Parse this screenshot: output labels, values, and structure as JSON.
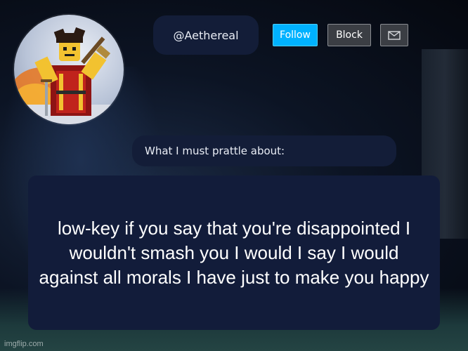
{
  "profile": {
    "username": "@Aethereal",
    "avatar_icon": "roblox-character-avatar-icon"
  },
  "actions": {
    "follow_label": "Follow",
    "block_label": "Block",
    "message_icon": "mail-icon"
  },
  "prompt": {
    "label": "What I must prattle about:"
  },
  "message": {
    "text": "low-key if you say that you're disappointed I wouldn't smash you I would I say I would against all morals I have just to make you happy"
  },
  "watermark": {
    "text": "imgflip.com"
  },
  "colors": {
    "pill_background": "#131d38",
    "follow_button": "#00b2ff",
    "secondary_button": "#3b3e44",
    "text_light": "#e9edf5"
  }
}
